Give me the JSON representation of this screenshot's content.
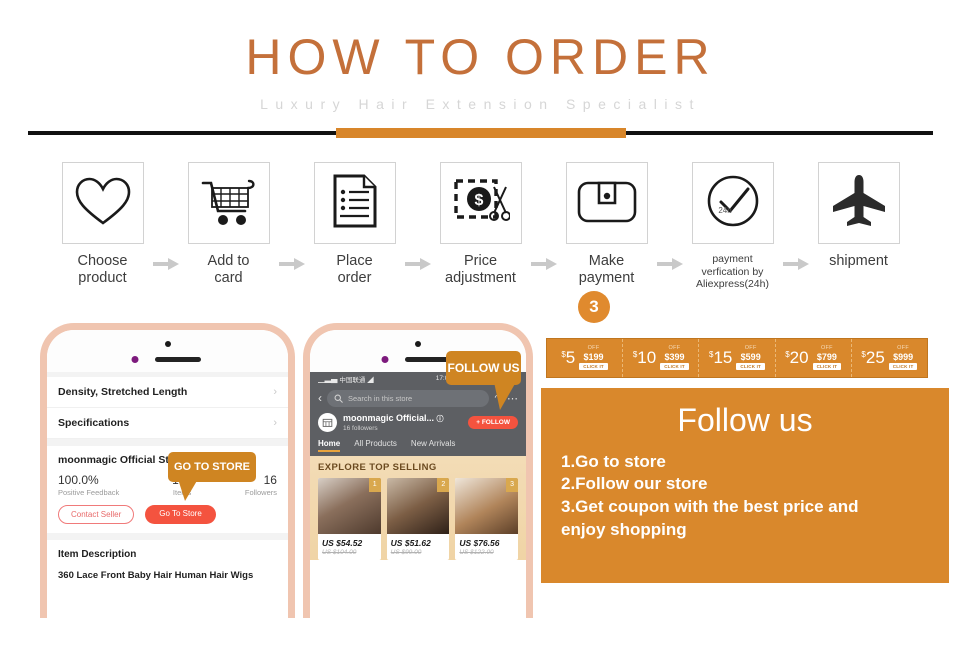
{
  "header": {
    "title": "HOW TO ORDER",
    "subtitle": "Luxury Hair Extension Specialist"
  },
  "steps": [
    {
      "icon": "heart-icon",
      "label_line1": "Choose",
      "label_line2": "product"
    },
    {
      "icon": "cart-icon",
      "label_line1": "Add to",
      "label_line2": "card"
    },
    {
      "icon": "document-icon",
      "label_line1": "Place",
      "label_line2": "order"
    },
    {
      "icon": "price-tag-scissors-icon",
      "label_line1": "Price",
      "label_line2": "adjustment"
    },
    {
      "icon": "wallet-icon",
      "label_line1": "Make",
      "label_line2": "payment"
    },
    {
      "icon": "clock-check-24h-icon",
      "label_line1": "payment",
      "label_line2": "verfication by",
      "label_line3": "Aliexpress(24h)",
      "small": true
    },
    {
      "icon": "airplane-icon",
      "label_line1": "shipment",
      "label_line2": ""
    }
  ],
  "phone1": {
    "rows": [
      {
        "label": "Density, Stretched Length",
        "chevron": "›"
      },
      {
        "label": "Specifications",
        "chevron": "›"
      }
    ],
    "store_name": "moonmagic Official Store",
    "stats": [
      {
        "value": "100.0%",
        "key": "Positive Feedback"
      },
      {
        "value": "157",
        "key": "Items"
      },
      {
        "value": "16",
        "key": "Followers"
      }
    ],
    "contact_button": "Contact Seller",
    "store_button": "Go To Store",
    "tooltip": "GO TO STORE",
    "description_heading": "Item Description",
    "description_text": "360 Lace Front Baby Hair Human Hair Wigs"
  },
  "phone2": {
    "carrier": "中国联通",
    "time": "17:06",
    "search_placeholder": "Search in this store",
    "store_name": "moonmagic Official...",
    "followers": "16  followers",
    "follow_button": "+ FOLLOW",
    "tooltip": "FOLLOW US",
    "tabs": [
      {
        "label": "Home",
        "active": true
      },
      {
        "label": "All Products",
        "active": false
      },
      {
        "label": "New Arrivals",
        "active": false
      }
    ],
    "promo_heading": "EXPLORE TOP SELLING",
    "products": [
      {
        "rank": "1",
        "price": "US $54.52",
        "old_price": "US $104.00"
      },
      {
        "rank": "2",
        "price": "US $51.62",
        "old_price": "US $99.00"
      },
      {
        "rank": "3",
        "price": "US $76.56",
        "old_price": "US $122.00"
      }
    ]
  },
  "right_panel": {
    "badge": "3",
    "coupons": [
      {
        "currency": "$",
        "amount": "5",
        "off_label": "OFF",
        "minimum": "$199",
        "click_label": "CLICK IT"
      },
      {
        "currency": "$",
        "amount": "10",
        "off_label": "OFF",
        "minimum": "$399",
        "click_label": "CLICK IT"
      },
      {
        "currency": "$",
        "amount": "15",
        "off_label": "OFF",
        "minimum": "$599",
        "click_label": "CLICK IT"
      },
      {
        "currency": "$",
        "amount": "20",
        "off_label": "OFF",
        "minimum": "$799",
        "click_label": "CLICK IT"
      },
      {
        "currency": "$",
        "amount": "25",
        "off_label": "OFF",
        "minimum": "$999",
        "click_label": "CLICK IT"
      }
    ],
    "follow_title": "Follow us",
    "follow_steps": [
      "1.Go to store",
      "2.Follow our store",
      "3.Get coupon with the best price and",
      " enjoy shopping"
    ]
  },
  "colors": {
    "accent_orange": "#d9882c",
    "title_orange": "#c4703a",
    "red_button": "#f4533f",
    "phone_frame": "#f0c5b0",
    "subtitle_grey": "#d6d6d6"
  }
}
